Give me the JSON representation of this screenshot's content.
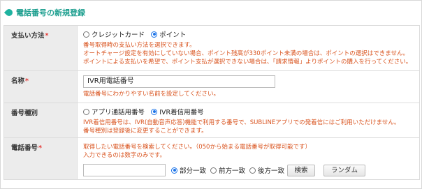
{
  "header": {
    "title": "電話番号の新規登録",
    "icon": "speech-bubble-icon",
    "accent": "#1fb3a0"
  },
  "payment": {
    "label": "支払い方法",
    "required_mark": "*",
    "options": [
      {
        "label": "クレジットカード",
        "selected": false
      },
      {
        "label": "ポイント",
        "selected": true
      }
    ],
    "notes": [
      "番号取得時の支払い方法を選択できます。",
      "オートチャージ設定を有効にしていない場合、ポイント残高が330ポイント未満の場合は、ポイントの選択はできません。",
      "ポイントによる支払いを希望で、ポイント支払が選択できない場合は、「請求情報」よりポイントの購入を行ってください。"
    ]
  },
  "name": {
    "label": "名称",
    "required_mark": "*",
    "value": "IVR用電話番号",
    "note": "電話番号にわかりやすい名前を設定してください。"
  },
  "number_type": {
    "label": "番号種別",
    "options": [
      {
        "label": "アプリ通話用番号",
        "selected": false
      },
      {
        "label": "IVR着信用番号",
        "selected": true
      }
    ],
    "notes": [
      "IVR着信用番号は、IVR(自動音声応答)機能で利用する番号で、SUBLINEアプリでの発着信にはご利用いただけません。",
      "番号種別は登録後に変更することができます。"
    ]
  },
  "phone": {
    "label": "電話番号",
    "required_mark": "*",
    "notes": [
      "取得したい電話番号を検索してください。（050から始まる電話番号が取得可能です）",
      "入力できるのは数字のみです。"
    ],
    "value": "",
    "match_options": [
      {
        "label": "部分一致",
        "selected": true
      },
      {
        "label": "前方一致",
        "selected": false
      },
      {
        "label": "後方一致",
        "selected": false
      }
    ],
    "search_button": "検索",
    "random_button": "ランダム"
  }
}
